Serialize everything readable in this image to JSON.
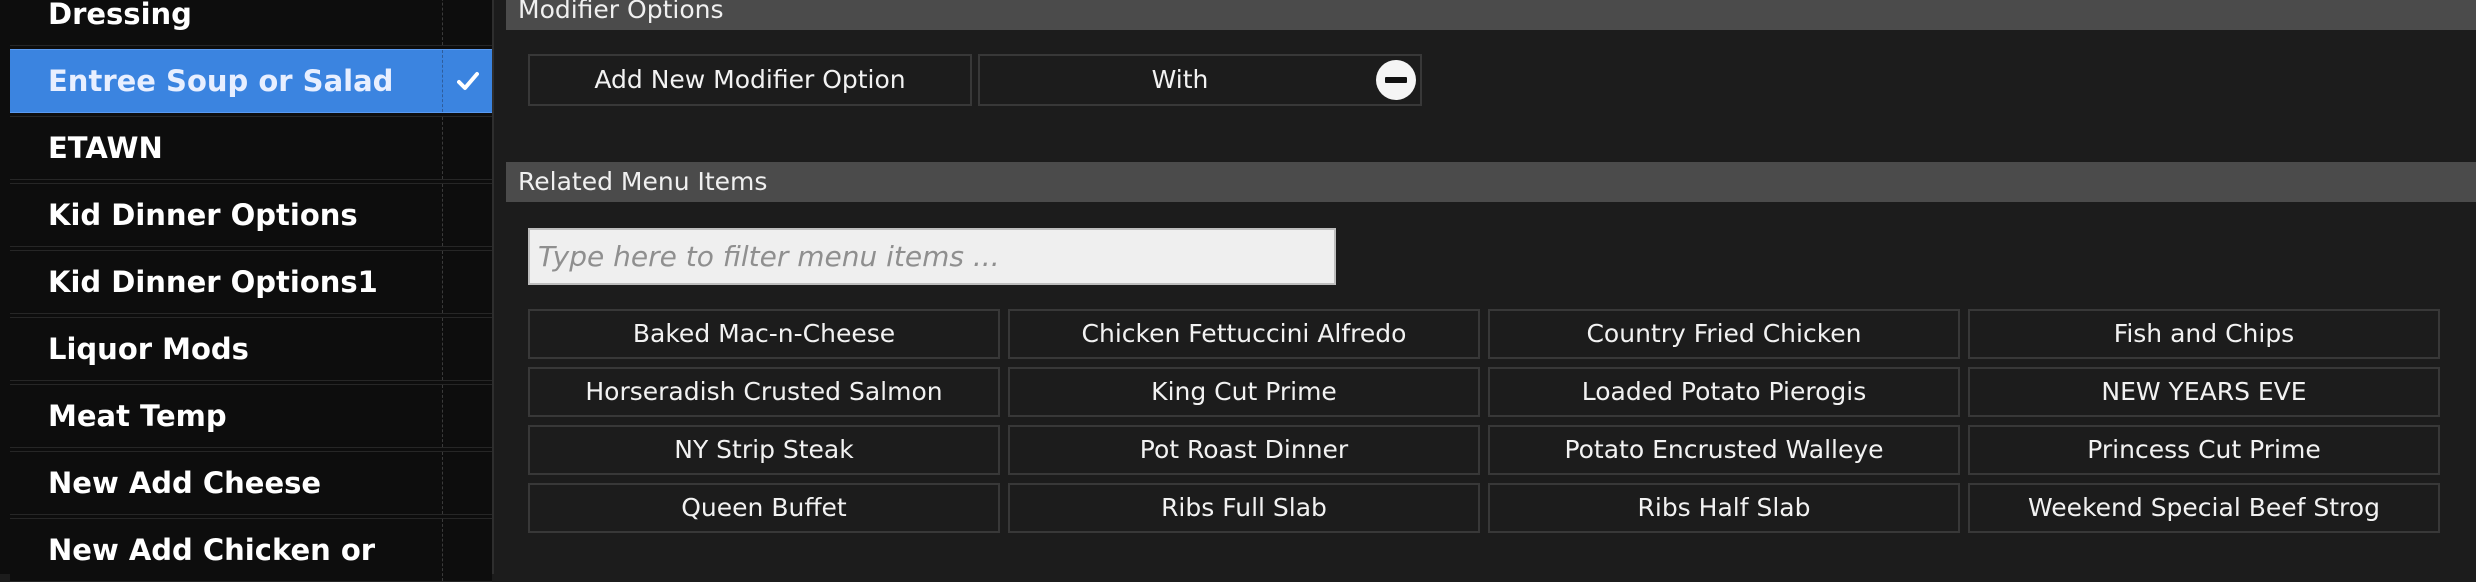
{
  "modifier_groups": [
    {
      "label": "Dressing",
      "selected": false
    },
    {
      "label": "Entree Soup or Salad",
      "selected": true
    },
    {
      "label": "ETAWN",
      "selected": false
    },
    {
      "label": "Kid Dinner Options",
      "selected": false
    },
    {
      "label": "Kid Dinner Options1",
      "selected": false
    },
    {
      "label": "Liquor Mods",
      "selected": false
    },
    {
      "label": "Meat Temp",
      "selected": false
    },
    {
      "label": "New Add Cheese",
      "selected": false
    },
    {
      "label": "New Add Chicken or",
      "selected": false
    }
  ],
  "modifier_options": {
    "header": "Modifier Options",
    "add_button": "Add New Modifier Option",
    "options": [
      {
        "label": "With",
        "icon": "remove-icon"
      }
    ]
  },
  "related": {
    "header": "Related Menu Items",
    "filter_placeholder": "Type here to filter menu items ...",
    "items": [
      "Baked Mac-n-Cheese",
      "Chicken Fettuccini Alfredo",
      "Country Fried Chicken",
      "Fish and Chips",
      "Horseradish Crusted Salmon",
      "King Cut Prime",
      "Loaded Potato Pierogis",
      "NEW YEARS EVE",
      "NY Strip Steak",
      "Pot Roast Dinner",
      "Potato Encrusted Walleye",
      "Princess Cut Prime",
      "Queen Buffet",
      "Ribs Full Slab",
      "Ribs Half Slab",
      "Weekend Special Beef Strog"
    ]
  },
  "colors": {
    "selected_row": "#3b84e0",
    "header_bar": "#4b4b4b",
    "background": "#1c1c1c"
  }
}
